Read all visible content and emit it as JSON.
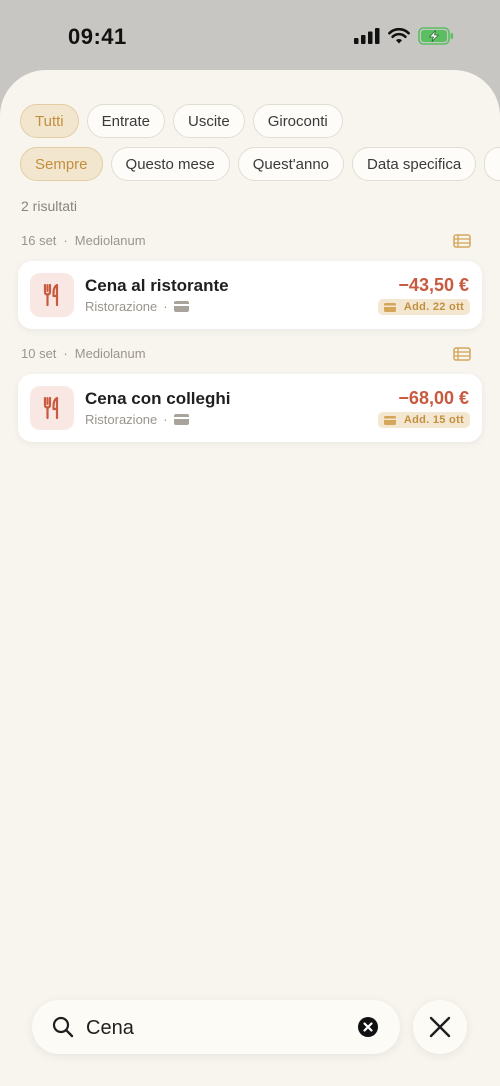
{
  "status_bar": {
    "time": "09:41"
  },
  "filters": {
    "type_chips": [
      {
        "label": "Tutti",
        "active": true
      },
      {
        "label": "Entrate",
        "active": false
      },
      {
        "label": "Uscite",
        "active": false
      },
      {
        "label": "Giroconti",
        "active": false
      }
    ],
    "period_chips": [
      {
        "label": "Sempre",
        "active": true
      },
      {
        "label": "Questo mese",
        "active": false
      },
      {
        "label": "Quest'anno",
        "active": false
      },
      {
        "label": "Data specifica",
        "active": false
      }
    ]
  },
  "results": {
    "count_label": "2 risultati",
    "groups": [
      {
        "date": "16 set",
        "account": "Mediolanum",
        "transaction": {
          "title": "Cena al ristorante",
          "category": "Ristorazione",
          "amount": "−43,50 €",
          "badge": "Add. 22 ott",
          "icon": "fork-knife-icon"
        }
      },
      {
        "date": "10 set",
        "account": "Mediolanum",
        "transaction": {
          "title": "Cena con colleghi",
          "category": "Ristorazione",
          "amount": "−68,00 €",
          "badge": "Add. 15 ott",
          "icon": "fork-knife-icon"
        }
      }
    ]
  },
  "search": {
    "value": "Cena"
  },
  "colors": {
    "accent": "#c28f3f",
    "expense": "#c85a3e",
    "background": "#f8f5ef"
  }
}
